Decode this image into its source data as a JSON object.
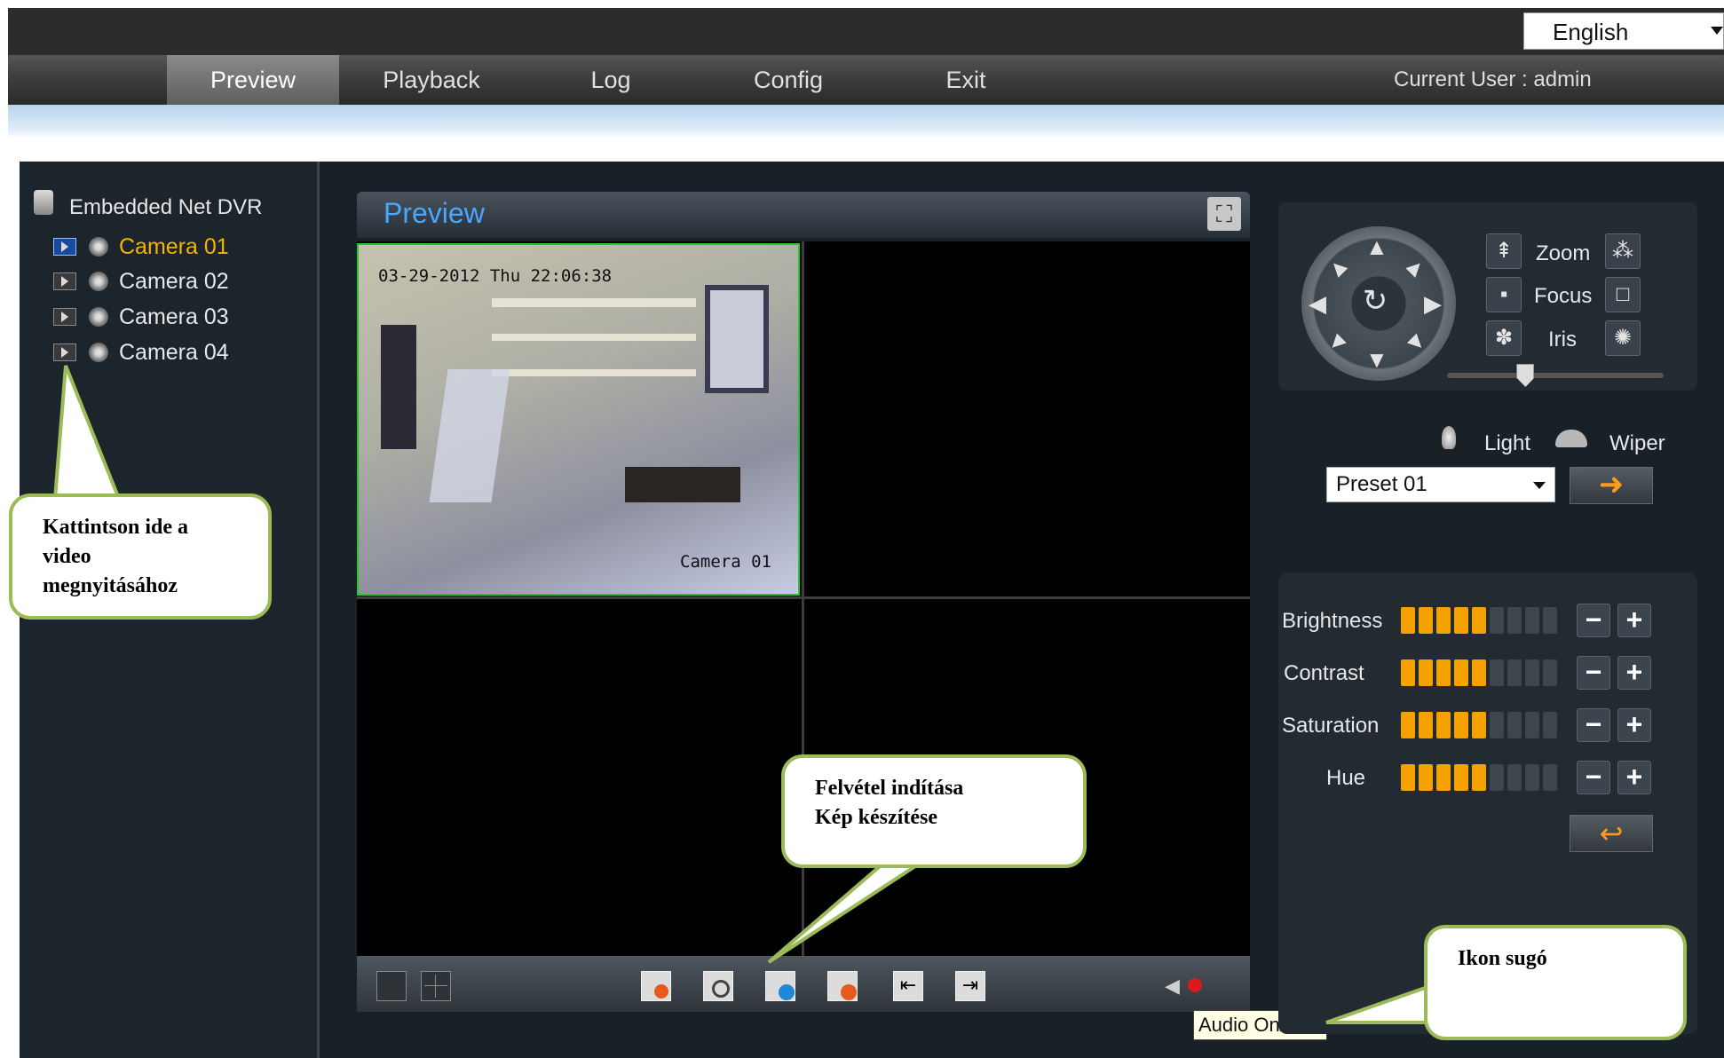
{
  "header": {
    "language": "English",
    "nav": [
      "Preview",
      "Playback",
      "Log",
      "Config",
      "Exit"
    ],
    "active_nav": "Preview",
    "current_user": "Current User : admin"
  },
  "sidebar": {
    "root": "Embedded Net DVR",
    "cameras": [
      "Camera 01",
      "Camera 02",
      "Camera 03",
      "Camera 04"
    ],
    "selected_camera": "Camera 01"
  },
  "preview": {
    "title": "Preview",
    "osd_timestamp": "03-29-2012 Thu 22:06:38",
    "osd_camera": "Camera 01"
  },
  "ptz": {
    "zoom_label": "Zoom",
    "focus_label": "Focus",
    "iris_label": "Iris",
    "light_label": "Light",
    "wiper_label": "Wiper",
    "preset_value": "Preset 01",
    "speed_level": 0.35
  },
  "image": {
    "rows": [
      {
        "label": "Brightness",
        "level": 5,
        "max": 9
      },
      {
        "label": "Contrast",
        "level": 5,
        "max": 9
      },
      {
        "label": "Saturation",
        "level": 5,
        "max": 9
      },
      {
        "label": "Hue",
        "level": 5,
        "max": 9
      }
    ]
  },
  "tooltip": "Audio On/Off",
  "callouts": {
    "open_video": [
      "Kattintson ide a",
      "video",
      "megnyitásához"
    ],
    "record": [
      "Felvétel indítása",
      "Kép készítése"
    ],
    "icon_help": "Ikon sugó"
  },
  "colors": {
    "accent_orange": "#f5a200",
    "selected_camera": "#f5b400",
    "preview_title": "#4aa6ff",
    "callout_border": "#9bbb59"
  }
}
